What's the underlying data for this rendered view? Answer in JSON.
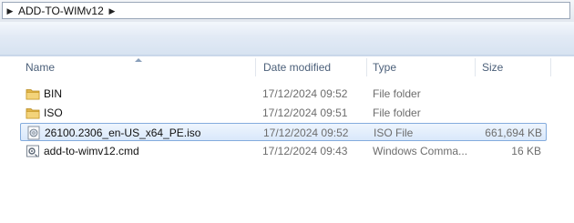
{
  "address": {
    "path": [
      "ADD-TO-WIMv12"
    ]
  },
  "columns": {
    "name": "Name",
    "date_modified": "Date modified",
    "type": "Type",
    "size": "Size"
  },
  "files": [
    {
      "name": "BIN",
      "date": "17/12/2024 09:52",
      "type": "File folder",
      "size": "",
      "icon": "folder-icon",
      "selected": false
    },
    {
      "name": "ISO",
      "date": "17/12/2024 09:51",
      "type": "File folder",
      "size": "",
      "icon": "folder-icon",
      "selected": false
    },
    {
      "name": "26100.2306_en-US_x64_PE.iso",
      "date": "17/12/2024 09:52",
      "type": "ISO File",
      "size": "661,694 KB",
      "icon": "disc-image-icon",
      "selected": true
    },
    {
      "name": "add-to-wimv12.cmd",
      "date": "17/12/2024 09:43",
      "type": "Windows Comma...",
      "size": "16 KB",
      "icon": "cmd-script-icon",
      "selected": false
    }
  ],
  "colors": {
    "selection_border": "#84acdd",
    "header_text": "#4c607a",
    "folder": "#e8c25a"
  }
}
